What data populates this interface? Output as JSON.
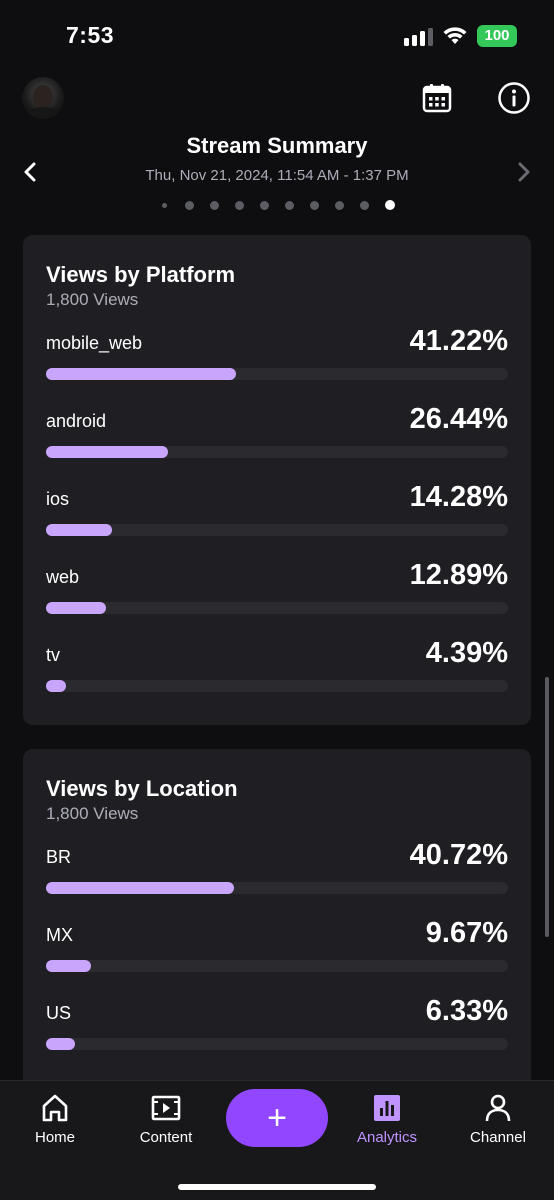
{
  "status_bar": {
    "time": "7:53",
    "battery": "100"
  },
  "header": {
    "title": "Stream Summary",
    "date": "Thu, Nov 21, 2024, 11:54 AM - 1:37 PM",
    "dot_count": 10,
    "active_dot": 9
  },
  "platform_card": {
    "title": "Views by Platform",
    "subtitle": "1,800 Views",
    "rows": [
      {
        "label": "mobile_web",
        "pct": "41.22%",
        "value": 41.22
      },
      {
        "label": "android",
        "pct": "26.44%",
        "value": 26.44
      },
      {
        "label": "ios",
        "pct": "14.28%",
        "value": 14.28
      },
      {
        "label": "web",
        "pct": "12.89%",
        "value": 12.89
      },
      {
        "label": "tv",
        "pct": "4.39%",
        "value": 4.39
      }
    ]
  },
  "location_card": {
    "title": "Views by Location",
    "subtitle": "1,800 Views",
    "rows": [
      {
        "label": "BR",
        "pct": "40.72%",
        "value": 40.72
      },
      {
        "label": "MX",
        "pct": "9.67%",
        "value": 9.67
      },
      {
        "label": "US",
        "pct": "6.33%",
        "value": 6.33
      }
    ]
  },
  "tabbar": {
    "home": "Home",
    "content": "Content",
    "create": "+",
    "analytics": "Analytics",
    "channel": "Channel"
  },
  "colors": {
    "accent": "#9147ff",
    "bar_fill": "#c9a6fb",
    "active_tab": "#bf94ff",
    "battery": "#34c759"
  },
  "icons": {
    "calendar": "calendar-icon",
    "info": "info-icon",
    "prev": "chevron-left-icon",
    "next": "chevron-right-icon",
    "home": "home-icon",
    "content": "video-content-icon",
    "analytics": "bar-chart-icon",
    "channel": "person-icon"
  }
}
